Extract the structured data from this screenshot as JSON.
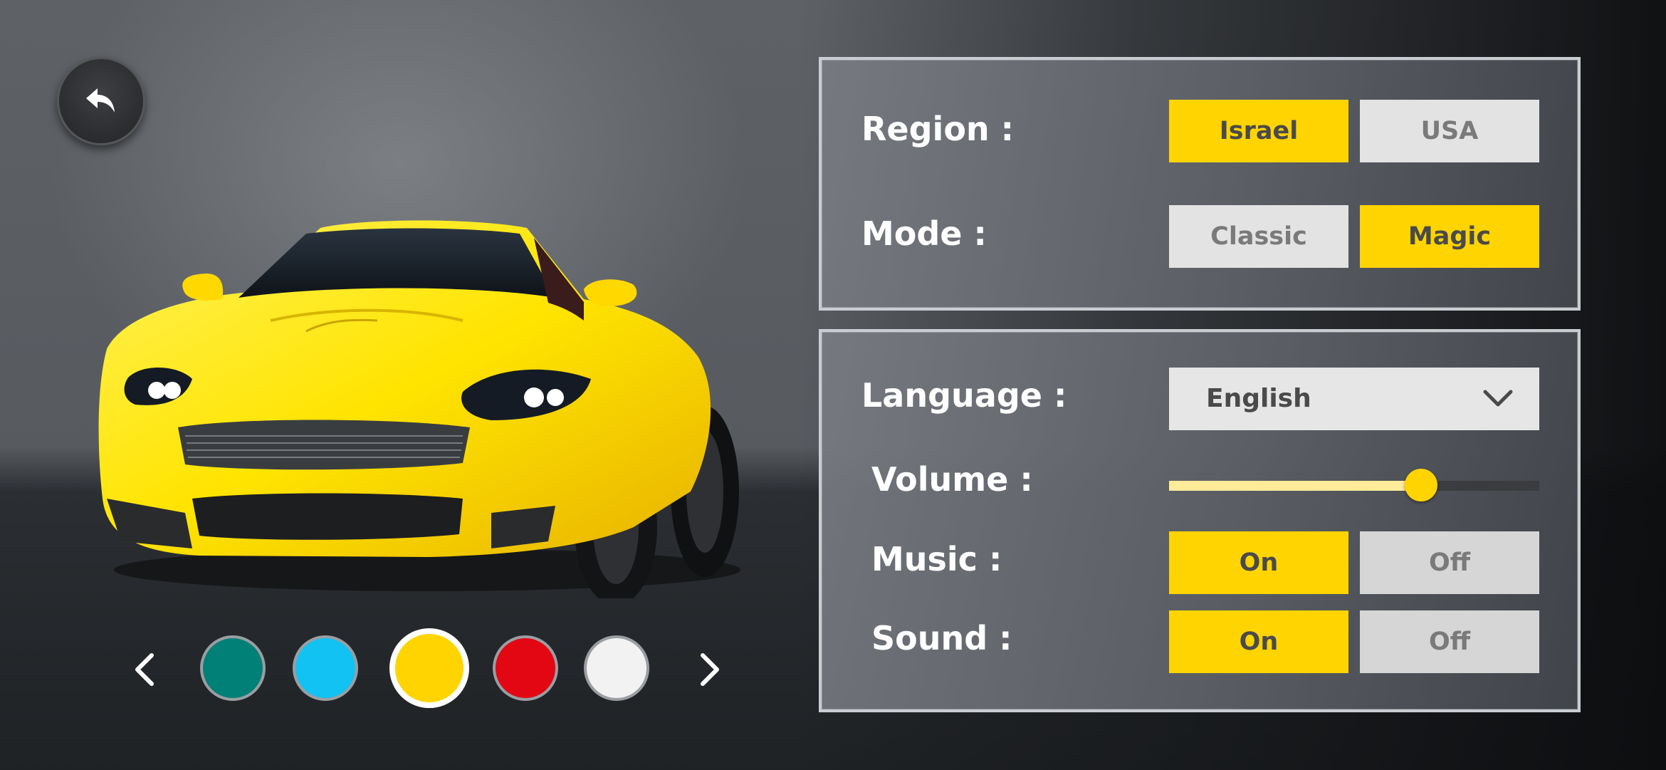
{
  "back": {
    "icon": "undo-arrow-icon"
  },
  "colors": {
    "accent": "#ffd400",
    "swatches": [
      "#008077",
      "#12c2f2",
      "#ffd400",
      "#e30613",
      "#f2f2f2"
    ],
    "selected_index": 2
  },
  "region": {
    "label": "Region :",
    "options": [
      "Israel",
      "USA"
    ],
    "selected": "Israel"
  },
  "mode": {
    "label": "Mode :",
    "options": [
      "Classic",
      "Magic"
    ],
    "selected": "Magic"
  },
  "language": {
    "label": "Language :",
    "value": "English",
    "icon": "chevron-down-icon"
  },
  "volume": {
    "label": "Volume :",
    "level": 0.68
  },
  "music": {
    "label": "Music :",
    "options": [
      "On",
      "Off"
    ],
    "selected": "On"
  },
  "sound": {
    "label": "Sound :",
    "options": [
      "On",
      "Off"
    ],
    "selected": "On"
  }
}
